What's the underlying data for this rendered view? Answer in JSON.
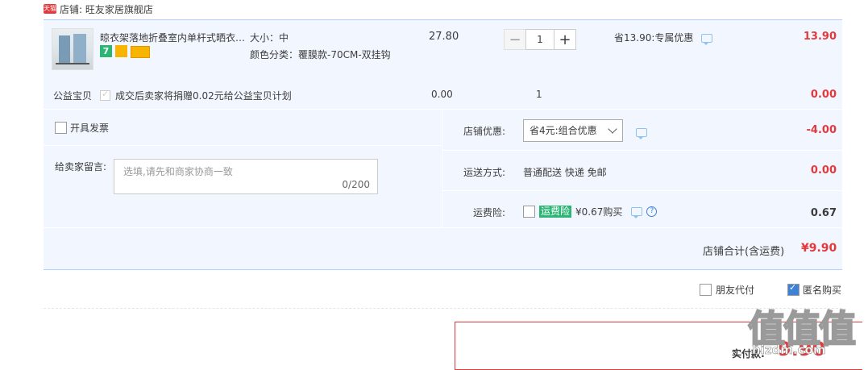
{
  "store": {
    "badge": "天猫",
    "label": "店铺: 旺友家居旗舰店"
  },
  "item": {
    "title": "晾衣架落地折叠室内单杆式晒衣…",
    "size": "大小：中",
    "color": "颜色分类：覆膜款-70CM-双挂钩",
    "badge_seven": "7",
    "price": "27.80",
    "qty": "1",
    "qty_minus": "−",
    "qty_plus": "+",
    "promo": "省13.90:专属优惠",
    "total": "13.90"
  },
  "charity": {
    "label": "公益宝贝",
    "text": "成交后卖家将捐赠0.02元给公益宝贝计划",
    "price": "0.00",
    "qty": "1",
    "total": "0.00"
  },
  "invoice": {
    "label": "开具发票"
  },
  "note": {
    "label": "给卖家留言:",
    "placeholder": "选填,请先和商家协商一致",
    "counter": "0/200"
  },
  "discount": {
    "label": "店铺优惠:",
    "selected": "省4元:组合优惠",
    "amount": "-4.00"
  },
  "shipping": {
    "label": "运送方式:",
    "value": "普通配送 快递 免邮",
    "amount": "0.00"
  },
  "insurance": {
    "label": "运费险:",
    "tag": "运费险",
    "price": "¥0.67购买",
    "amount": "0.67"
  },
  "subtotal": {
    "label": "店铺合计(含运费)",
    "amount": "¥9.90"
  },
  "options": {
    "friend_pay": "朋友代付",
    "anonymous": "匿名购买"
  },
  "payment": {
    "label": "实付款:",
    "amount": "9.90"
  },
  "watermark": {
    "glyphs": "值值值",
    "url": "hizdm.com"
  },
  "colors": {
    "accent_red": "#e4393c",
    "panel_bg": "#f2f7ff",
    "border_blue": "#b2d1ff",
    "check_blue": "#3d82d6",
    "tag_green": "#2bb673"
  },
  "icons": [
    "tmall-icon",
    "message-icon",
    "question-icon",
    "chevron-down-icon",
    "check-icon"
  ]
}
